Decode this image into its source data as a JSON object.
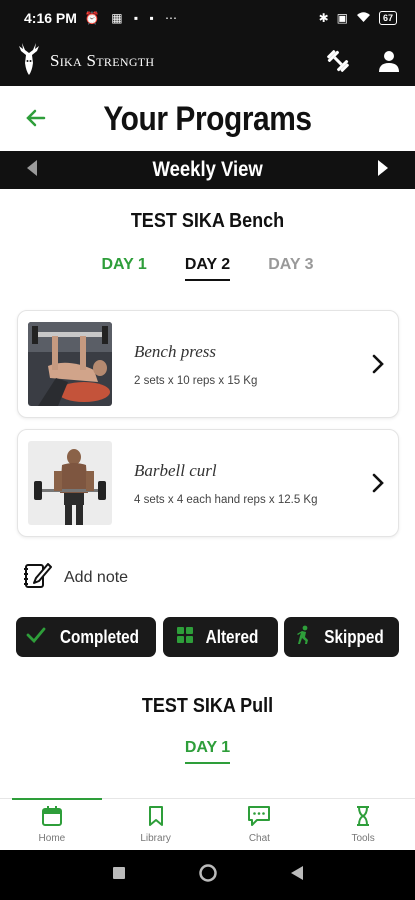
{
  "status_bar": {
    "time": "4:16 PM",
    "battery": "67"
  },
  "app_bar": {
    "brand": "Sika Strength"
  },
  "page": {
    "title": "Your Programs",
    "weekly_view": "Weekly View"
  },
  "programs": [
    {
      "title": "TEST SIKA Bench",
      "days": [
        "DAY 1",
        "DAY 2",
        "DAY 3"
      ],
      "selected_day": "DAY 2",
      "exercises": [
        {
          "name": "Bench press",
          "detail": "2 sets x 10 reps x 15 Kg"
        },
        {
          "name": "Barbell curl",
          "detail": "4 sets x 4 each hand reps x 12.5 Kg"
        }
      ]
    },
    {
      "title": "TEST SIKA Pull",
      "days": [
        "DAY 1"
      ]
    }
  ],
  "note": {
    "label": "Add note"
  },
  "status_buttons": {
    "completed": "Completed",
    "altered": "Altered",
    "skipped": "Skipped"
  },
  "bottom_nav": {
    "home": "Home",
    "library": "Library",
    "chat": "Chat",
    "tools": "Tools"
  },
  "colors": {
    "accent": "#2e9e3a",
    "dark": "#111111"
  }
}
